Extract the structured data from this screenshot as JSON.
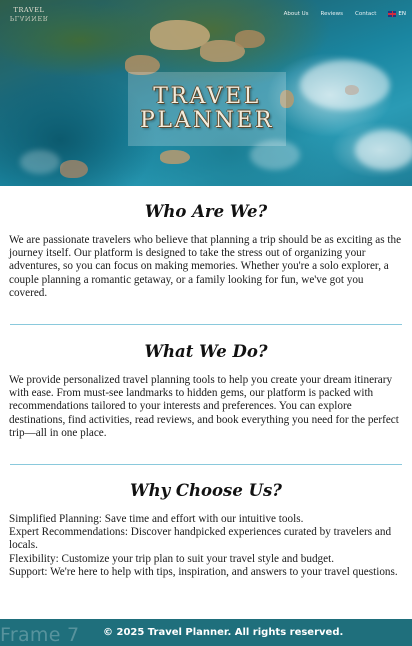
{
  "header": {
    "logo_line1": "TRAVEL",
    "logo_line2": "PLANNER",
    "nav": [
      {
        "label": "About Us"
      },
      {
        "label": "Reviews"
      },
      {
        "label": "Contact"
      }
    ],
    "language": {
      "code": "EN",
      "icon": "uk-flag-icon"
    }
  },
  "hero": {
    "title_line1": "TRAVEL",
    "title_line2": "PLANNER"
  },
  "sections": [
    {
      "title": "Who Are We?",
      "body": "We are passionate travelers who believe that planning a trip should be as exciting as the journey itself. Our platform is designed to take the stress out of organizing your adventures, so you can focus on making memories. Whether you're a solo explorer, a couple planning a romantic getaway, or a family looking for fun, we've got you covered."
    },
    {
      "title": "What We Do?",
      "body": "We provide personalized travel planning tools to help you create your dream itinerary with ease. From must-see landmarks to hidden gems, our platform is packed with recommendations tailored to your interests and preferences. You can explore destinations, find activities, read reviews, and book everything you need for the perfect trip—all in one place."
    },
    {
      "title": "Why Choose Us?",
      "items": [
        "Simplified Planning: Save time and effort with our intuitive tools.",
        "Expert Recommendations: Discover handpicked experiences curated by travelers and locals.",
        "Flexibility: Customize your trip plan to suit your travel style and budget.",
        "Support: We're here to help with tips, inspiration, and answers to your travel questions."
      ]
    }
  ],
  "footer": {
    "frame_label": "Frame 7",
    "copyright": "© 2025 Travel Planner. All rights reserved."
  },
  "colors": {
    "footer_bg": "#1f6f7c",
    "divider": "#8ac9dc"
  }
}
